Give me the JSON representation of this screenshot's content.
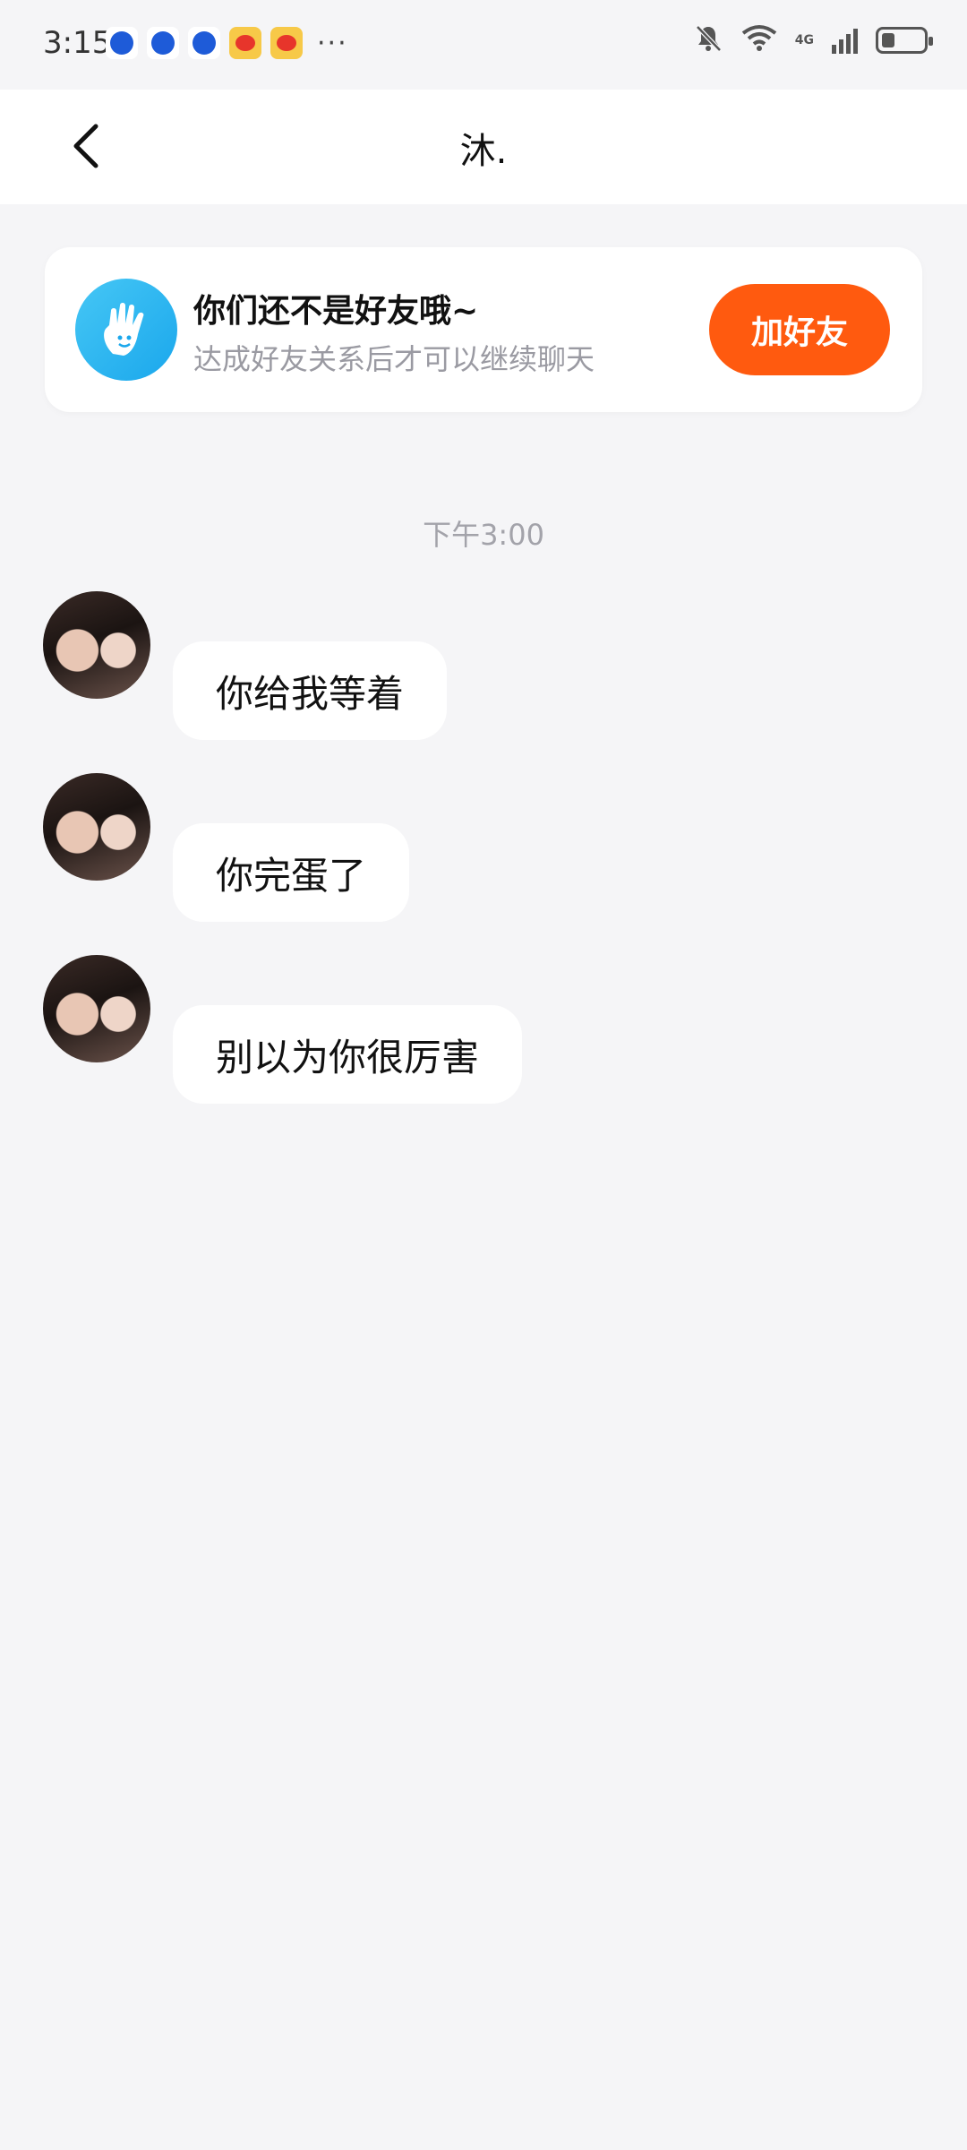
{
  "status_bar": {
    "time": "3:15",
    "more": "···",
    "network": "4G"
  },
  "header": {
    "title": "沐."
  },
  "friend_card": {
    "title": "你们还不是好友哦~",
    "subtitle": "达成好友关系后才可以继续聊天",
    "add_button": "加好友"
  },
  "chat": {
    "timestamp": "下午3:00",
    "messages": [
      {
        "text": "你给我等着"
      },
      {
        "text": "你完蛋了"
      },
      {
        "text": "别以为你很厉害"
      }
    ]
  },
  "colors": {
    "accent": "#ff5a0f",
    "card_icon": "#1aa7ec",
    "background": "#f5f5f7"
  }
}
